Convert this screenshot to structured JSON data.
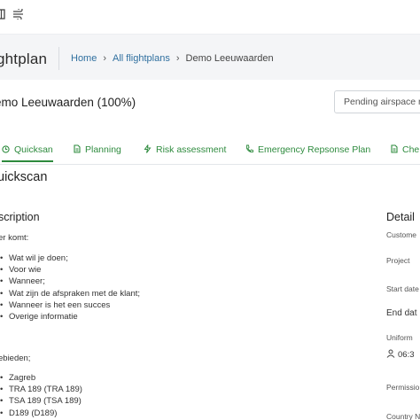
{
  "toolbar": {
    "icons": [
      "columns-icon",
      "filter-lines-icon"
    ]
  },
  "header": {
    "title": "ghtplan",
    "breadcrumb": {
      "home": "Home",
      "all": "All flightplans",
      "current": "Demo Leeuwaarden"
    }
  },
  "plan": {
    "title": "emo Leeuwaarden (100%)",
    "status": "Pending airspace r"
  },
  "tabs": [
    {
      "label": "Quicksan",
      "icon": "clock-icon",
      "active": true
    },
    {
      "label": "Planning",
      "icon": "document-icon",
      "active": false
    },
    {
      "label": "Risk assessment",
      "icon": "bolt-icon",
      "active": false
    },
    {
      "label": "Emergency Repsonse Plan",
      "icon": "phone-icon",
      "active": false
    },
    {
      "label": "Che",
      "icon": "document-icon",
      "active": false
    }
  ],
  "section": {
    "title": "uickscan"
  },
  "description": {
    "title": "scription",
    "intro": "er komt:",
    "items": [
      "Wat wil je doen;",
      "Voor wie",
      "Wanneer;",
      "Wat zijn de afspraken met de klant;",
      "Wanneer is het een succes",
      "Overige informatie"
    ],
    "areas_intro": "ebieden;",
    "areas": [
      "Zagreb",
      "TRA 189 (TRA 189)",
      "TSA 189 (TSA 189)",
      "D189 (D189)"
    ]
  },
  "details": {
    "title": "Detail",
    "customer_label": "Custome",
    "project_label": "Project",
    "start_label": "Start date",
    "end_label": "End dat",
    "uniform_label": "Uniform",
    "uniform_value": "06:3",
    "permission_label": "Permissio",
    "country_label": "Country N"
  }
}
